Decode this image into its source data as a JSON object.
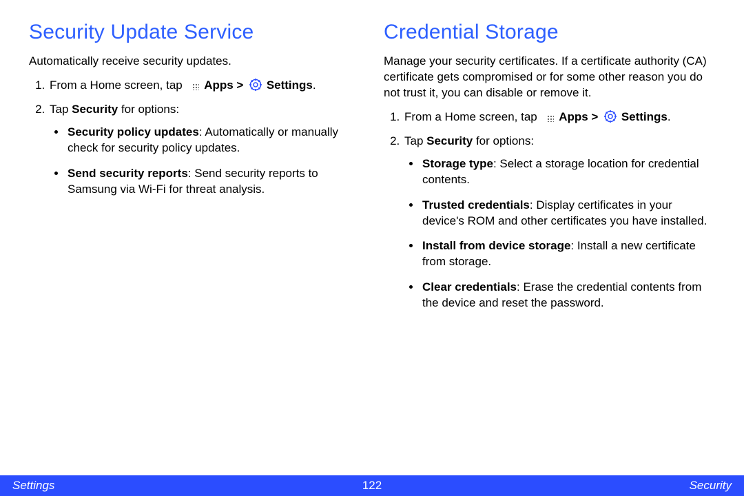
{
  "left": {
    "heading": "Security Update Service",
    "intro": "Automatically receive security updates.",
    "step1_pre": "From a Home screen, tap ",
    "apps_label": "Apps",
    "gt": " > ",
    "settings_label": "Settings",
    "step1_post": ".",
    "step2_pre": "Tap ",
    "step2_bold": "Security",
    "step2_post": " for options:",
    "bullets": [
      {
        "title": "Security policy updates",
        "text": ": Automatically or manually check for security policy updates."
      },
      {
        "title": "Send security reports",
        "text": ": Send security reports to Samsung via Wi-Fi for threat analysis."
      }
    ]
  },
  "right": {
    "heading": "Credential Storage",
    "intro": "Manage your security certificates. If a certificate authority (CA) certificate gets compromised or for some other reason you do not trust it, you can disable or remove it.",
    "step1_pre": "From a Home screen, tap ",
    "apps_label": "Apps",
    "gt": " > ",
    "settings_label": "Settings",
    "step1_post": ".",
    "step2_pre": "Tap ",
    "step2_bold": "Security",
    "step2_post": " for options:",
    "bullets": [
      {
        "title": "Storage type",
        "text": ": Select a storage location for credential contents."
      },
      {
        "title": "Trusted credentials",
        "text": ": Display certificates in your device's ROM and other certificates you have installed."
      },
      {
        "title": "Install from device storage",
        "text": ": Install a new certificate from storage."
      },
      {
        "title": "Clear credentials",
        "text": ": Erase the credential contents from the device and reset the password."
      }
    ]
  },
  "footer": {
    "left": "Settings",
    "center": "122",
    "right": "Security"
  }
}
